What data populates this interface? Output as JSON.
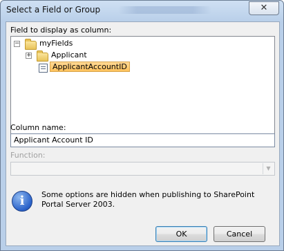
{
  "window": {
    "title": "Select a Field or Group",
    "close_glyph": "✕"
  },
  "tree_section": {
    "label": "Field to display as column:",
    "nodes": [
      {
        "label": "myFields",
        "expander": "−",
        "icon": "folder-open-icon"
      },
      {
        "label": "Applicant",
        "expander": "+",
        "icon": "folder-icon"
      },
      {
        "label": "ApplicantAccountID",
        "icon": "field-icon",
        "selected": true
      }
    ]
  },
  "column_name": {
    "label": "Column name:",
    "value": "Applicant Account ID"
  },
  "function": {
    "label": "Function:",
    "value": "",
    "enabled": false
  },
  "info": {
    "icon": "info-icon",
    "text": "Some options are hidden when publishing to SharePoint Portal Server 2003."
  },
  "buttons": {
    "ok": "OK",
    "cancel": "Cancel"
  }
}
